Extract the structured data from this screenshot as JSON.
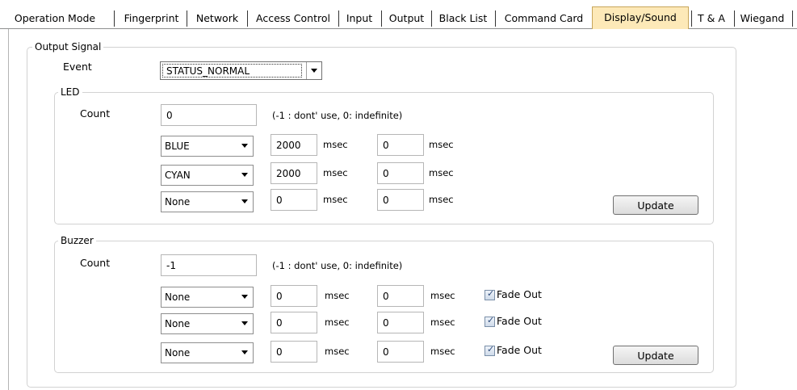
{
  "tabs": [
    {
      "label": "Operation Mode",
      "active": false
    },
    {
      "label": "Fingerprint",
      "active": false
    },
    {
      "label": "Network",
      "active": false
    },
    {
      "label": "Access Control",
      "active": false
    },
    {
      "label": "Input",
      "active": false
    },
    {
      "label": "Output",
      "active": false
    },
    {
      "label": "Black List",
      "active": false
    },
    {
      "label": "Command Card",
      "active": false
    },
    {
      "label": "Display/Sound",
      "active": true
    },
    {
      "label": "T & A",
      "active": false
    },
    {
      "label": "Wiegand",
      "active": false
    }
  ],
  "output_signal": {
    "legend": "Output Signal",
    "event_label": "Event",
    "event_value": "STATUS_NORMAL"
  },
  "led": {
    "legend": "LED",
    "count_label": "Count",
    "count_value": "0",
    "count_hint": "(-1 : dont' use, 0: indefinite)",
    "rows": [
      {
        "color": "BLUE",
        "on": "2000",
        "on_unit": "msec",
        "off": "0",
        "off_unit": "msec"
      },
      {
        "color": "CYAN",
        "on": "2000",
        "on_unit": "msec",
        "off": "0",
        "off_unit": "msec"
      },
      {
        "color": "None",
        "on": "0",
        "on_unit": "msec",
        "off": "0",
        "off_unit": "msec"
      }
    ],
    "update_label": "Update"
  },
  "buzzer": {
    "legend": "Buzzer",
    "count_label": "Count",
    "count_value": "-1",
    "count_hint": "(-1 : dont' use, 0: indefinite)",
    "rows": [
      {
        "tone": "None",
        "on": "0",
        "on_unit": "msec",
        "off": "0",
        "off_unit": "msec",
        "fade_label": "Fade Out",
        "fade_checked": true
      },
      {
        "tone": "None",
        "on": "0",
        "on_unit": "msec",
        "off": "0",
        "off_unit": "msec",
        "fade_label": "Fade Out",
        "fade_checked": true
      },
      {
        "tone": "None",
        "on": "0",
        "on_unit": "msec",
        "off": "0",
        "off_unit": "msec",
        "fade_label": "Fade Out",
        "fade_checked": true
      }
    ],
    "update_label": "Update"
  },
  "colors": {
    "active_tab": "#fde9b8",
    "border": "#d2d2d2"
  }
}
